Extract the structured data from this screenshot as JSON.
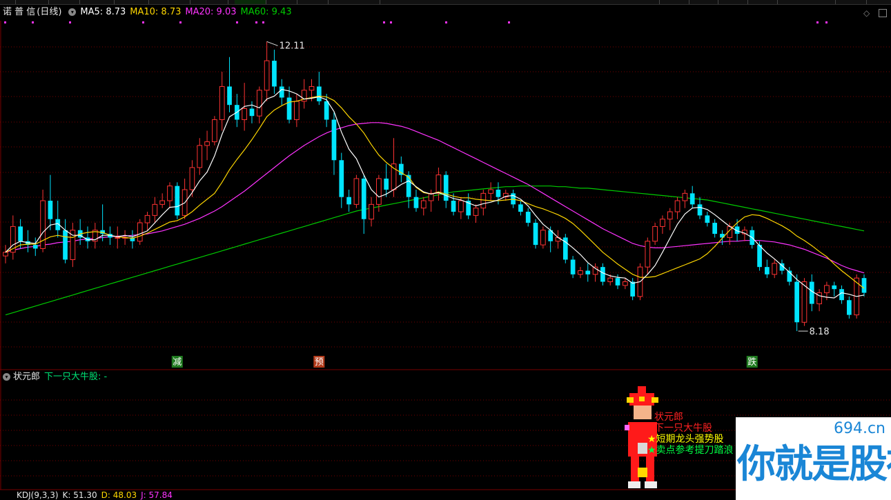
{
  "header": {
    "stock_name": "诺 普 信",
    "period": "(日线)",
    "ma5": "MA5: 8.73",
    "ma10": "MA10: 8.73",
    "ma20": "MA20: 9.03",
    "ma60": "MA60: 9.43"
  },
  "colors": {
    "up": "#ff3333",
    "down": "#00e5ff",
    "ma5": "#ffffff",
    "ma10": "#ffd700",
    "ma20": "#ff33ff",
    "ma60": "#00cc00",
    "grid": "#7a0000"
  },
  "annotations": {
    "high_label": "12.11",
    "low_label": "8.18"
  },
  "signals": [
    {
      "text": "减",
      "bg": "#1f7a1f"
    },
    {
      "text": "预",
      "bg": "#b33a1a"
    },
    {
      "text": "跌",
      "bg": "#1f7a1f"
    }
  ],
  "indicator": {
    "name": "状元郎",
    "label": "下一只大牛股: -"
  },
  "overlay": {
    "line1": "状元郎",
    "line2": "下一只大牛股",
    "line3": "★短期龙头强势股",
    "line4": "★卖点参考提刀踏浪"
  },
  "kdj": {
    "name": "KDJ(9,3,3)",
    "k": "K: 51.30",
    "d": "D: 48.03",
    "j": "J: 57.84"
  },
  "watermark": {
    "url": "694.cn",
    "text": "你就是股神"
  },
  "chart_data": {
    "type": "candlestick",
    "ylim": [
      7.9,
      12.3
    ],
    "candles": [
      [
        9.2,
        9.35,
        9.1,
        9.25
      ],
      [
        9.25,
        9.75,
        9.15,
        9.6
      ],
      [
        9.6,
        9.7,
        9.3,
        9.4
      ],
      [
        9.4,
        9.55,
        9.25,
        9.35
      ],
      [
        9.35,
        9.45,
        9.2,
        9.3
      ],
      [
        9.3,
        10.1,
        9.25,
        9.95
      ],
      [
        9.95,
        10.3,
        9.55,
        9.7
      ],
      [
        9.7,
        9.95,
        9.45,
        9.55
      ],
      [
        9.55,
        9.7,
        9.1,
        9.15
      ],
      [
        9.15,
        9.65,
        9.05,
        9.55
      ],
      [
        9.55,
        9.7,
        9.35,
        9.45
      ],
      [
        9.45,
        9.6,
        9.3,
        9.4
      ],
      [
        9.4,
        9.65,
        9.3,
        9.55
      ],
      [
        9.55,
        9.9,
        9.4,
        9.5
      ],
      [
        9.5,
        9.6,
        9.35,
        9.45
      ],
      [
        9.45,
        9.6,
        9.3,
        9.45
      ],
      [
        9.45,
        9.55,
        9.35,
        9.45
      ],
      [
        9.45,
        9.55,
        9.3,
        9.4
      ],
      [
        9.4,
        9.7,
        9.35,
        9.65
      ],
      [
        9.65,
        9.8,
        9.55,
        9.75
      ],
      [
        9.75,
        10.0,
        9.65,
        9.9
      ],
      [
        9.9,
        10.05,
        9.85,
        9.95
      ],
      [
        9.95,
        10.2,
        9.85,
        10.15
      ],
      [
        10.15,
        10.2,
        9.7,
        9.75
      ],
      [
        9.75,
        10.25,
        9.7,
        10.1
      ],
      [
        10.1,
        10.5,
        10.0,
        10.4
      ],
      [
        10.4,
        10.8,
        10.3,
        10.7
      ],
      [
        10.7,
        10.9,
        10.5,
        10.75
      ],
      [
        10.75,
        11.1,
        10.7,
        11.05
      ],
      [
        11.05,
        11.7,
        10.9,
        11.5
      ],
      [
        11.5,
        11.9,
        11.15,
        11.25
      ],
      [
        11.25,
        11.4,
        10.95,
        11.05
      ],
      [
        11.05,
        11.55,
        10.9,
        11.2
      ],
      [
        11.2,
        11.3,
        11.0,
        11.1
      ],
      [
        11.1,
        11.5,
        11.0,
        11.45
      ],
      [
        11.45,
        12.11,
        11.3,
        11.85
      ],
      [
        11.85,
        12.0,
        11.4,
        11.5
      ],
      [
        11.5,
        11.6,
        11.25,
        11.35
      ],
      [
        11.35,
        11.5,
        11.0,
        11.05
      ],
      [
        11.05,
        11.4,
        10.95,
        11.3
      ],
      [
        11.3,
        11.6,
        11.2,
        11.45
      ],
      [
        11.45,
        11.6,
        11.3,
        11.5
      ],
      [
        11.5,
        11.7,
        11.25,
        11.3
      ],
      [
        11.3,
        11.4,
        10.95,
        11.05
      ],
      [
        11.05,
        11.15,
        10.3,
        10.5
      ],
      [
        10.5,
        10.6,
        9.85,
        10.0
      ],
      [
        10.0,
        10.1,
        9.8,
        9.9
      ],
      [
        9.9,
        10.3,
        9.85,
        10.25
      ],
      [
        10.25,
        10.3,
        9.5,
        9.7
      ],
      [
        9.7,
        10.0,
        9.6,
        9.9
      ],
      [
        9.9,
        10.3,
        9.8,
        10.25
      ],
      [
        10.25,
        10.45,
        10.0,
        10.1
      ],
      [
        10.1,
        10.8,
        10.0,
        10.45
      ],
      [
        10.45,
        10.55,
        10.2,
        10.3
      ],
      [
        10.3,
        10.35,
        9.85,
        10.0
      ],
      [
        10.0,
        10.1,
        9.8,
        9.85
      ],
      [
        9.85,
        10.0,
        9.75,
        9.95
      ],
      [
        9.95,
        10.1,
        9.8,
        10.05
      ],
      [
        10.05,
        10.4,
        9.95,
        10.3
      ],
      [
        10.3,
        10.35,
        9.85,
        9.95
      ],
      [
        9.95,
        10.05,
        9.75,
        9.8
      ],
      [
        9.8,
        10.0,
        9.7,
        9.95
      ],
      [
        9.95,
        10.05,
        9.7,
        9.75
      ],
      [
        9.75,
        9.9,
        9.65,
        9.85
      ],
      [
        9.85,
        10.1,
        9.75,
        10.05
      ],
      [
        10.05,
        10.2,
        9.95,
        10.1
      ],
      [
        10.1,
        10.2,
        9.9,
        10.0
      ],
      [
        10.0,
        10.1,
        9.95,
        10.05
      ],
      [
        10.05,
        10.1,
        9.85,
        9.9
      ],
      [
        9.9,
        9.95,
        9.75,
        9.8
      ],
      [
        9.8,
        9.85,
        9.6,
        9.65
      ],
      [
        9.65,
        9.7,
        9.3,
        9.35
      ],
      [
        9.35,
        9.6,
        9.3,
        9.55
      ],
      [
        9.55,
        9.6,
        9.25,
        9.4
      ],
      [
        9.4,
        9.55,
        9.3,
        9.45
      ],
      [
        9.45,
        9.5,
        9.1,
        9.15
      ],
      [
        9.15,
        9.2,
        8.9,
        8.95
      ],
      [
        8.95,
        9.05,
        8.9,
        9.0
      ],
      [
        9.0,
        9.1,
        8.85,
        8.95
      ],
      [
        8.95,
        9.1,
        8.85,
        9.05
      ],
      [
        9.05,
        9.1,
        8.8,
        8.85
      ],
      [
        8.85,
        8.95,
        8.8,
        8.9
      ],
      [
        8.9,
        8.95,
        8.75,
        8.8
      ],
      [
        8.8,
        8.9,
        8.75,
        8.85
      ],
      [
        8.85,
        8.9,
        8.6,
        8.65
      ],
      [
        8.65,
        9.1,
        8.6,
        9.05
      ],
      [
        9.05,
        9.45,
        8.95,
        9.4
      ],
      [
        9.4,
        9.65,
        9.35,
        9.6
      ],
      [
        9.6,
        9.75,
        9.5,
        9.7
      ],
      [
        9.7,
        9.85,
        9.55,
        9.8
      ],
      [
        9.8,
        10.0,
        9.7,
        9.95
      ],
      [
        9.95,
        10.1,
        9.85,
        10.05
      ],
      [
        10.05,
        10.15,
        9.85,
        9.9
      ],
      [
        9.9,
        10.0,
        9.7,
        9.75
      ],
      [
        9.75,
        9.8,
        9.6,
        9.65
      ],
      [
        9.65,
        9.7,
        9.45,
        9.5
      ],
      [
        9.5,
        9.55,
        9.35,
        9.45
      ],
      [
        9.45,
        9.65,
        9.35,
        9.6
      ],
      [
        9.6,
        9.7,
        9.4,
        9.5
      ],
      [
        9.5,
        9.6,
        9.4,
        9.55
      ],
      [
        9.55,
        9.6,
        9.3,
        9.35
      ],
      [
        9.35,
        9.4,
        9.0,
        9.05
      ],
      [
        9.05,
        9.15,
        8.9,
        8.95
      ],
      [
        8.95,
        9.15,
        8.9,
        9.1
      ],
      [
        9.1,
        9.15,
        8.95,
        9.0
      ],
      [
        9.0,
        9.05,
        8.8,
        8.85
      ],
      [
        8.85,
        8.95,
        8.18,
        8.3
      ],
      [
        8.3,
        8.9,
        8.25,
        8.85
      ],
      [
        8.85,
        8.95,
        8.45,
        8.55
      ],
      [
        8.55,
        8.75,
        8.45,
        8.7
      ],
      [
        8.7,
        8.85,
        8.6,
        8.8
      ],
      [
        8.8,
        8.85,
        8.65,
        8.75
      ],
      [
        8.75,
        8.8,
        8.55,
        8.6
      ],
      [
        8.6,
        8.65,
        8.35,
        8.4
      ],
      [
        8.4,
        8.95,
        8.35,
        8.9
      ],
      [
        8.9,
        8.95,
        8.65,
        8.7
      ]
    ],
    "ma5": [
      9.25,
      9.35,
      9.4,
      9.38,
      9.37,
      9.52,
      9.62,
      9.64,
      9.55,
      9.48,
      9.48,
      9.42,
      9.42,
      9.48,
      9.48,
      9.46,
      9.48,
      9.46,
      9.5,
      9.54,
      9.65,
      9.76,
      9.86,
      9.87,
      9.92,
      10.06,
      10.22,
      10.34,
      10.56,
      10.85,
      11.09,
      11.15,
      11.23,
      11.25,
      11.21,
      11.33,
      11.37,
      11.46,
      11.44,
      11.4,
      11.33,
      11.34,
      11.36,
      11.32,
      11.16,
      10.88,
      10.65,
      10.52,
      10.3,
      10.1,
      10.0,
      10.04,
      10.1,
      10.17,
      10.22,
      10.14,
      10.07,
      10.04,
      10.06,
      10.02,
      9.98,
      9.96,
      9.92,
      9.88,
      9.91,
      9.93,
      9.96,
      10.01,
      10.02,
      9.97,
      9.88,
      9.75,
      9.63,
      9.55,
      9.45,
      9.39,
      9.31,
      9.22,
      9.11,
      9.03,
      8.97,
      8.93,
      8.91,
      8.9,
      8.83,
      8.85,
      8.95,
      9.07,
      9.25,
      9.44,
      9.63,
      9.77,
      9.85,
      9.86,
      9.83,
      9.76,
      9.68,
      9.6,
      9.54,
      9.51,
      9.45,
      9.34,
      9.24,
      9.16,
      9.07,
      8.98,
      8.88,
      8.8,
      8.72,
      8.66,
      8.64,
      8.63,
      8.7,
      8.68,
      8.65,
      8.67
    ],
    "ma10": [
      9.25,
      9.3,
      9.35,
      9.36,
      9.36,
      9.41,
      9.46,
      9.48,
      9.46,
      9.45,
      9.5,
      9.52,
      9.53,
      9.52,
      9.48,
      9.46,
      9.45,
      9.44,
      9.47,
      9.51,
      9.56,
      9.61,
      9.66,
      9.68,
      9.73,
      9.8,
      9.89,
      9.97,
      10.05,
      10.2,
      10.37,
      10.51,
      10.64,
      10.78,
      10.93,
      11.09,
      11.18,
      11.24,
      11.29,
      11.3,
      11.33,
      11.35,
      11.37,
      11.36,
      11.31,
      11.21,
      11.09,
      10.99,
      10.87,
      10.71,
      10.57,
      10.47,
      10.39,
      10.33,
      10.27,
      10.13,
      10.06,
      10.04,
      10.07,
      10.04,
      10.01,
      9.99,
      9.99,
      9.97,
      9.96,
      9.95,
      9.95,
      9.96,
      9.97,
      9.95,
      9.91,
      9.87,
      9.84,
      9.8,
      9.76,
      9.71,
      9.64,
      9.55,
      9.45,
      9.35,
      9.25,
      9.17,
      9.09,
      9.02,
      8.95,
      8.91,
      8.91,
      8.92,
      8.96,
      9.0,
      9.04,
      9.08,
      9.12,
      9.16,
      9.23,
      9.33,
      9.44,
      9.55,
      9.65,
      9.73,
      9.76,
      9.75,
      9.71,
      9.66,
      9.61,
      9.55,
      9.47,
      9.41,
      9.34,
      9.26,
      9.19,
      9.09,
      9.0,
      8.92,
      8.84,
      8.76
    ],
    "ma20": [
      9.25,
      9.28,
      9.3,
      9.32,
      9.33,
      9.35,
      9.36,
      9.38,
      9.39,
      9.4,
      9.42,
      9.43,
      9.44,
      9.45,
      9.46,
      9.47,
      9.47,
      9.48,
      9.49,
      9.5,
      9.52,
      9.54,
      9.57,
      9.6,
      9.63,
      9.67,
      9.71,
      9.76,
      9.81,
      9.87,
      9.94,
      10.01,
      10.08,
      10.16,
      10.24,
      10.32,
      10.4,
      10.48,
      10.56,
      10.63,
      10.7,
      10.76,
      10.82,
      10.87,
      10.91,
      10.94,
      10.97,
      10.99,
      11.0,
      11.01,
      11.01,
      11.0,
      10.98,
      10.96,
      10.93,
      10.89,
      10.85,
      10.81,
      10.77,
      10.72,
      10.67,
      10.62,
      10.57,
      10.52,
      10.47,
      10.42,
      10.37,
      10.32,
      10.27,
      10.22,
      10.17,
      10.11,
      10.05,
      9.99,
      9.93,
      9.87,
      9.81,
      9.75,
      9.69,
      9.63,
      9.57,
      9.52,
      9.47,
      9.42,
      9.37,
      9.34,
      9.32,
      9.31,
      9.31,
      9.32,
      9.33,
      9.34,
      9.35,
      9.36,
      9.37,
      9.38,
      9.39,
      9.4,
      9.4,
      9.41,
      9.41,
      9.41,
      9.4,
      9.39,
      9.37,
      9.35,
      9.32,
      9.29,
      9.25,
      9.21,
      9.17,
      9.12,
      9.07,
      9.03,
      9.0,
      8.97
    ],
    "ma60": [
      8.4,
      8.43,
      8.46,
      8.49,
      8.52,
      8.55,
      8.58,
      8.61,
      8.64,
      8.67,
      8.7,
      8.73,
      8.76,
      8.79,
      8.82,
      8.85,
      8.88,
      8.91,
      8.94,
      8.97,
      9.0,
      9.03,
      9.06,
      9.09,
      9.12,
      9.15,
      9.18,
      9.21,
      9.24,
      9.27,
      9.3,
      9.33,
      9.36,
      9.39,
      9.42,
      9.45,
      9.48,
      9.51,
      9.54,
      9.57,
      9.6,
      9.63,
      9.66,
      9.69,
      9.72,
      9.75,
      9.78,
      9.81,
      9.83,
      9.85,
      9.87,
      9.89,
      9.91,
      9.93,
      9.95,
      9.97,
      9.99,
      10.01,
      10.03,
      10.05,
      10.07,
      10.08,
      10.09,
      10.1,
      10.11,
      10.12,
      10.13,
      10.14,
      10.14,
      10.15,
      10.15,
      10.15,
      10.15,
      10.15,
      10.14,
      10.14,
      10.13,
      10.12,
      10.12,
      10.11,
      10.1,
      10.09,
      10.08,
      10.07,
      10.06,
      10.05,
      10.04,
      10.03,
      10.02,
      10.01,
      10.0,
      9.99,
      9.98,
      9.97,
      9.96,
      9.94,
      9.92,
      9.9,
      9.88,
      9.86,
      9.84,
      9.82,
      9.8,
      9.78,
      9.76,
      9.74,
      9.72,
      9.7,
      9.68,
      9.66,
      9.64,
      9.62,
      9.6,
      9.58,
      9.56,
      9.54
    ]
  }
}
